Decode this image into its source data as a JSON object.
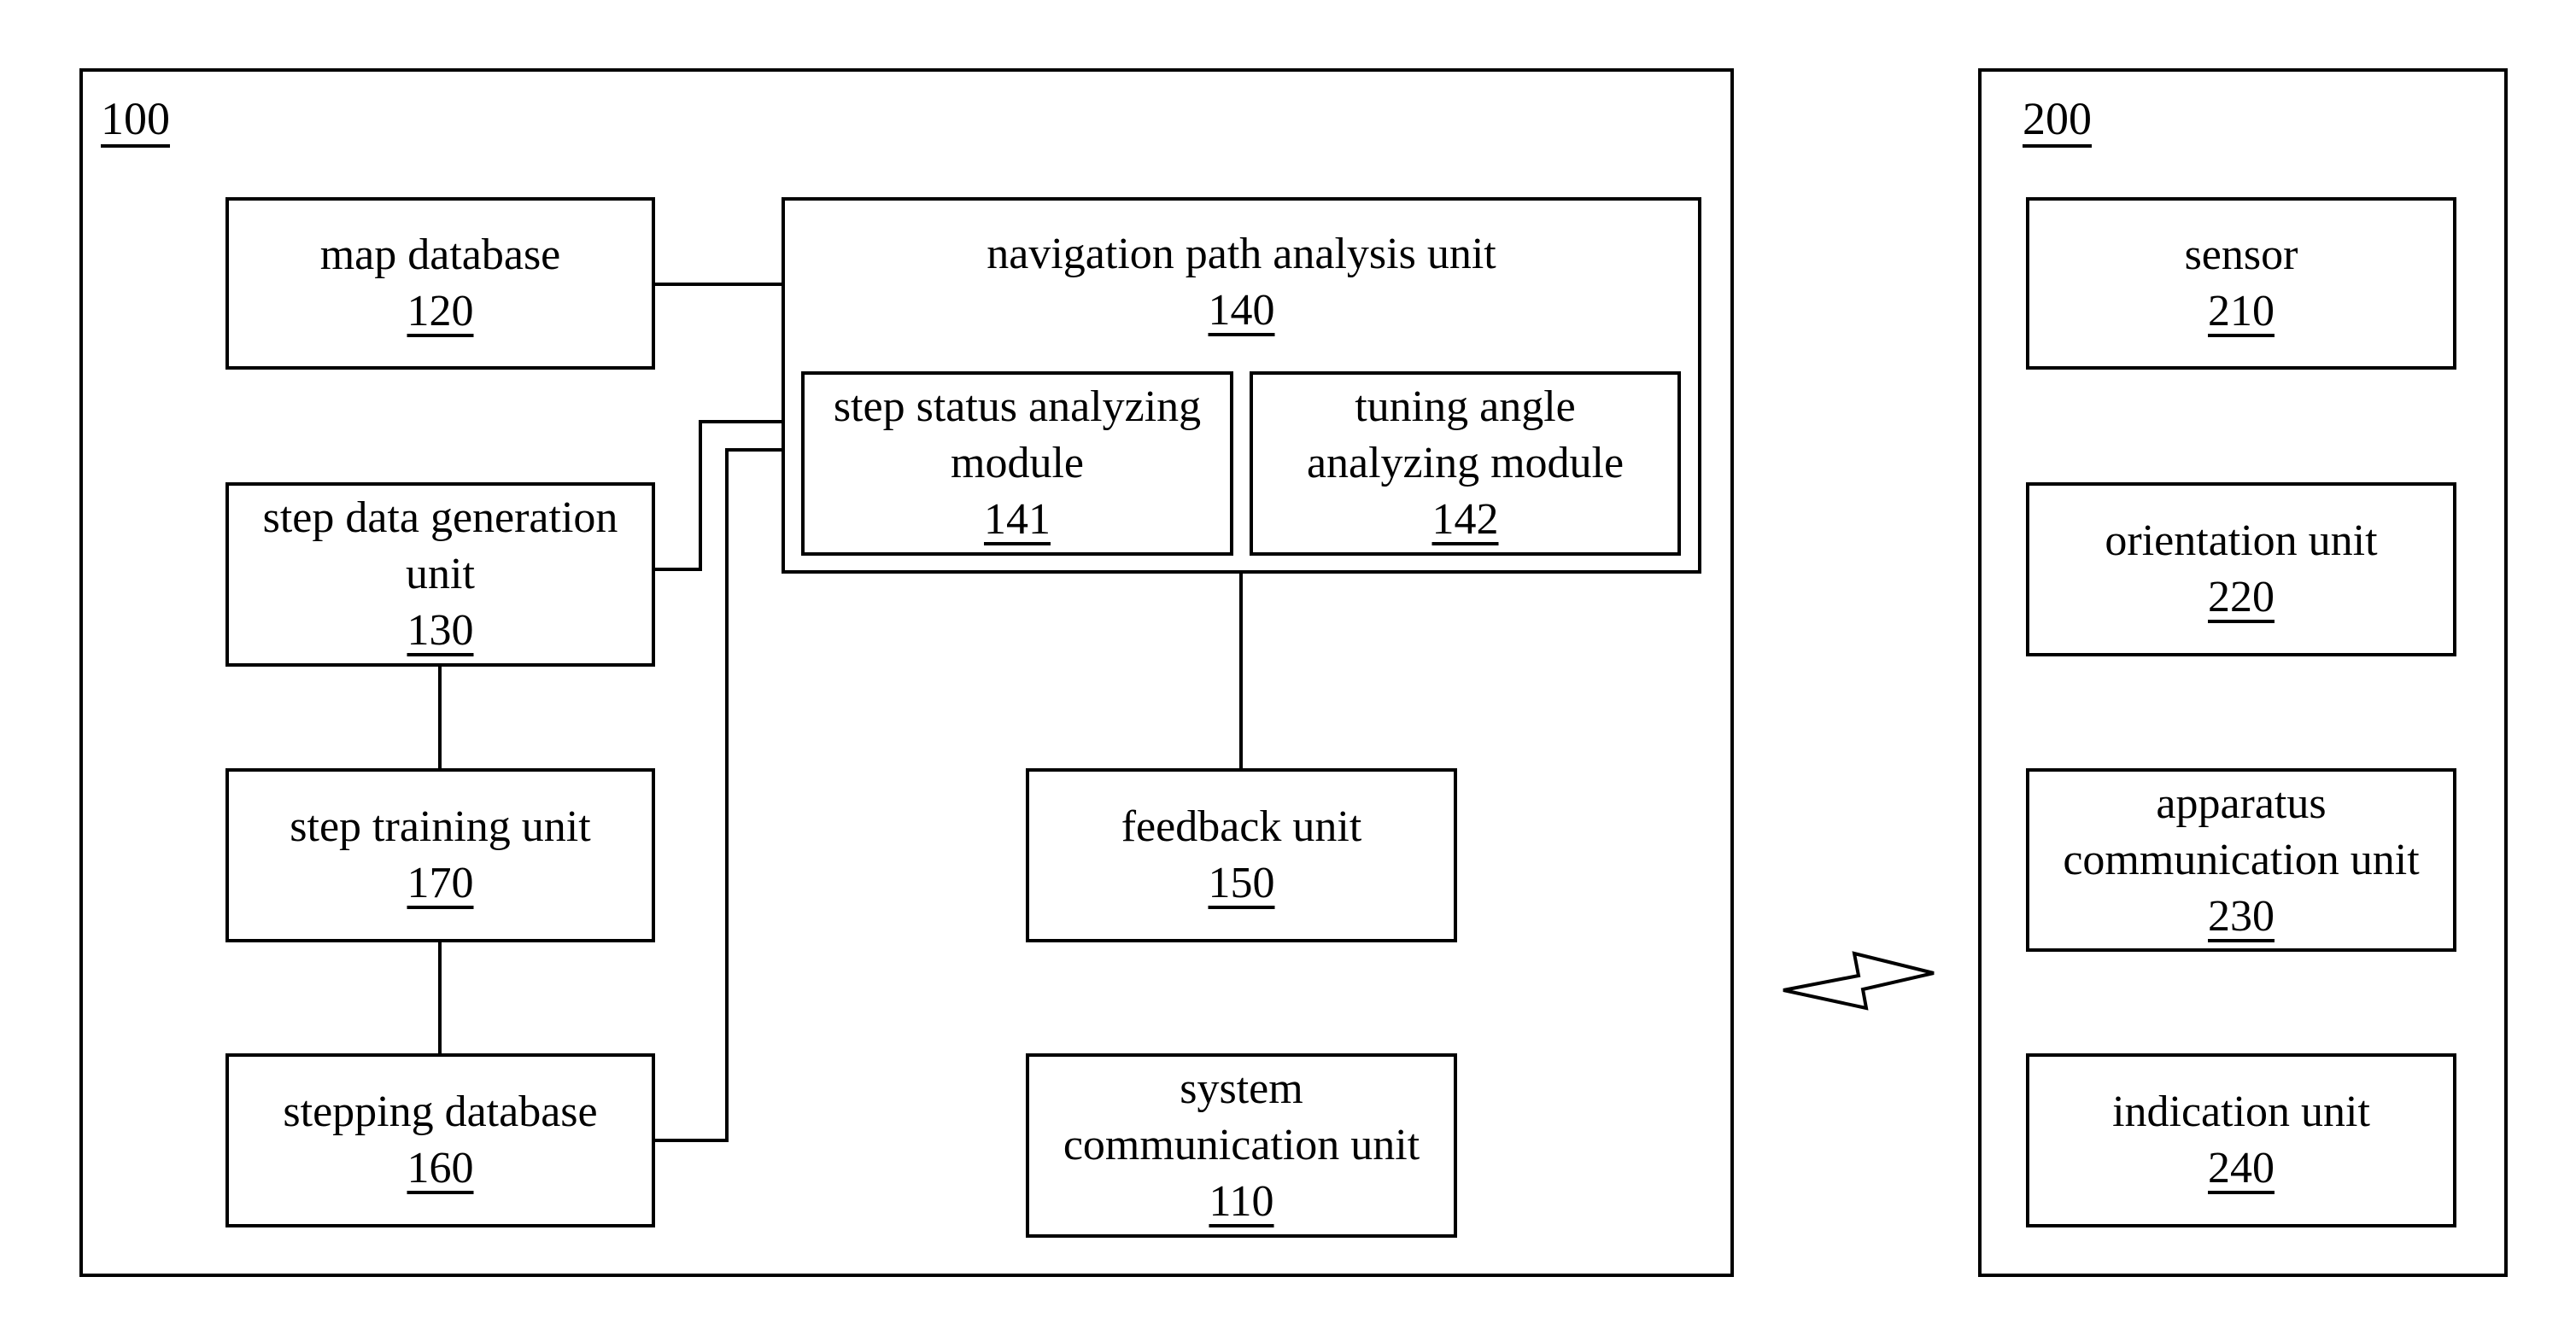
{
  "systems": [
    {
      "id": "100"
    },
    {
      "id": "200"
    }
  ],
  "units": {
    "u120": {
      "label": "map database",
      "number": "120"
    },
    "u140": {
      "label": "navigation path analysis unit",
      "number": "140"
    },
    "u141": {
      "label": "step status analyzing\nmodule",
      "number": "141"
    },
    "u142": {
      "label": "tuning angle\nanalyzing module",
      "number": "142"
    },
    "u130": {
      "label": "step data generation\nunit",
      "number": "130"
    },
    "u170": {
      "label": "step training unit",
      "number": "170"
    },
    "u160": {
      "label": "stepping database",
      "number": "160"
    },
    "u150": {
      "label": "feedback unit",
      "number": "150"
    },
    "u110": {
      "label": "system\ncommunication unit",
      "number": "110"
    },
    "u210": {
      "label": "sensor",
      "number": "210"
    },
    "u220": {
      "label": "orientation unit",
      "number": "220"
    },
    "u230": {
      "label": "apparatus\ncommunication unit",
      "number": "230"
    },
    "u240": {
      "label": "indication unit",
      "number": "240"
    }
  },
  "connections": [
    {
      "from": "120",
      "to": "140"
    },
    {
      "from": "130",
      "to": "140"
    },
    {
      "from": "160",
      "to": "140"
    },
    {
      "from": "130",
      "to": "170"
    },
    {
      "from": "170",
      "to": "160"
    },
    {
      "from": "140",
      "to": "150"
    }
  ],
  "wireless_link": {
    "between": [
      "100",
      "200"
    ],
    "icon": "lightning-bidirectional-arrow-icon"
  }
}
